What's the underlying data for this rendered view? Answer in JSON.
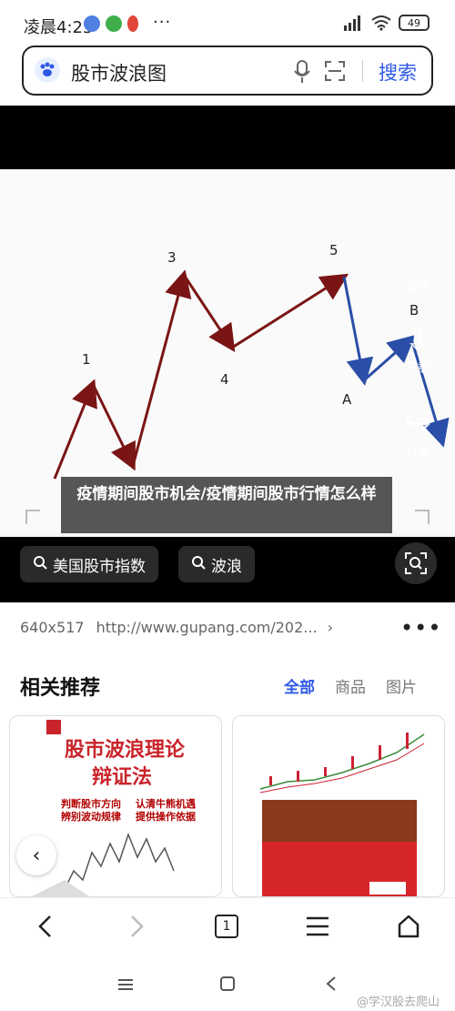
{
  "status_bar": {
    "time": "凌晨4:25",
    "more": "···",
    "battery": "49"
  },
  "search": {
    "query": "股市波浪图",
    "submit_label": "搜索"
  },
  "image": {
    "wave_labels": {
      "p1": "1",
      "p3": "3",
      "p4": "4",
      "p5": "5",
      "pA": "A",
      "pB": "B"
    },
    "caption": "疫情期间股市机会/疫情期间股市行情怎么样",
    "side_actions": {
      "like": "喜欢",
      "download": "下载",
      "share": "分享"
    }
  },
  "chips": [
    {
      "label": "美国股市指数"
    },
    {
      "label": "波浪"
    }
  ],
  "meta": {
    "dimensions": "640x517",
    "url": "http://www.gupang.com/202..."
  },
  "recommend": {
    "title": "相关推荐",
    "tabs": [
      "全部",
      "商品",
      "图片"
    ]
  },
  "cards": {
    "left": {
      "title_line1": "股市波浪理论",
      "title_line2": "辩证法",
      "tag1": "判断股市方向",
      "tag2": "认清牛熊机遇",
      "tag3": "辨别波动规律",
      "tag4": "提供操作依据"
    }
  },
  "bottom_nav": {
    "tab_count": "1"
  },
  "watermark": "@学汉股去爬山"
}
